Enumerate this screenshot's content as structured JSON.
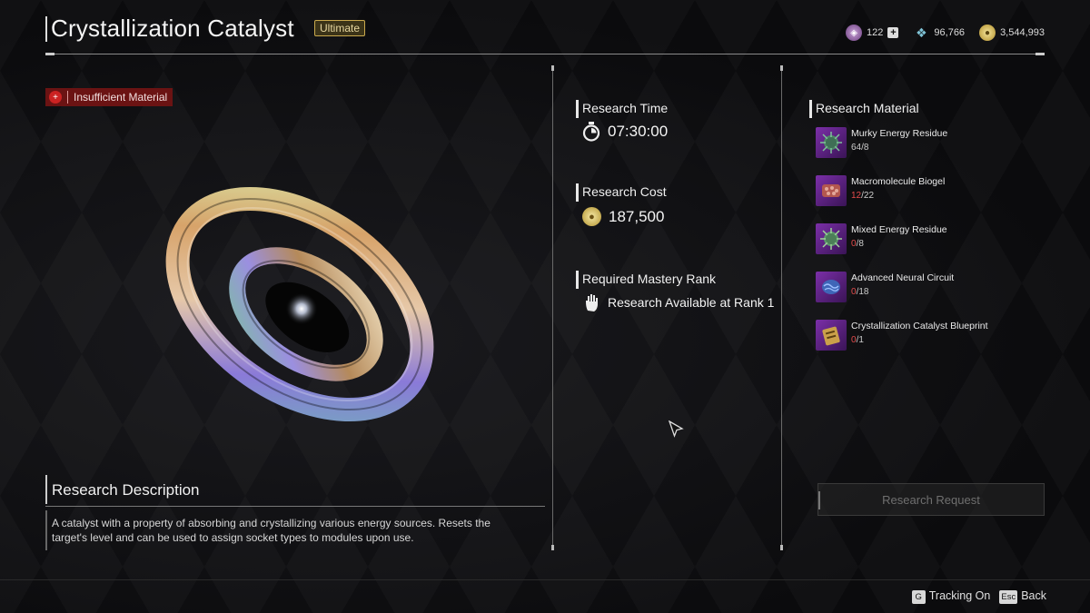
{
  "header": {
    "title": "Crystallization Catalyst",
    "grade_badge": "Ultimate",
    "currencies": [
      {
        "icon": "energy-activator-icon",
        "value": "122"
      },
      {
        "icon": "kuiper-shard-icon",
        "value": "96,766"
      },
      {
        "icon": "gold-coin-icon",
        "value": "3,544,993"
      }
    ]
  },
  "warning": {
    "text": "Insufficient Material",
    "color": "#6b1313"
  },
  "description": {
    "title": "Research Description",
    "text": "A catalyst with a property of absorbing and crystallizing various energy sources. Resets the target's level and can be used to assign socket types to modules upon use."
  },
  "research": {
    "time_label": "Research Time",
    "time_value": "07:30:00",
    "cost_label": "Research Cost",
    "cost_value": "187,500",
    "rank_label": "Required Mastery Rank",
    "rank_value": "Research Available at Rank 1"
  },
  "materials": {
    "title": "Research Material",
    "items": [
      {
        "name": "Murky Energy Residue",
        "have": "64",
        "need": "/8",
        "sufficient": true,
        "icon": "energy-residue-icon"
      },
      {
        "name": "Macromolecule Biogel",
        "have": "12",
        "need": "/22",
        "sufficient": false,
        "icon": "biogel-icon"
      },
      {
        "name": "Mixed Energy Residue",
        "have": "0",
        "need": "/8",
        "sufficient": false,
        "icon": "energy-residue-icon"
      },
      {
        "name": "Advanced Neural Circuit",
        "have": "0",
        "need": "/18",
        "sufficient": false,
        "icon": "neural-circuit-icon"
      },
      {
        "name": "Crystallization Catalyst Blueprint",
        "have": "0",
        "need": "/1",
        "sufficient": false,
        "icon": "blueprint-icon"
      }
    ]
  },
  "request_button": "Research Request",
  "footer": {
    "tracking_key": "G",
    "tracking_label": "Tracking On",
    "back_key": "Esc",
    "back_label": "Back"
  },
  "colors": {
    "accent_gold": "#c9a94d",
    "insufficient_red": "#e24b4b"
  }
}
